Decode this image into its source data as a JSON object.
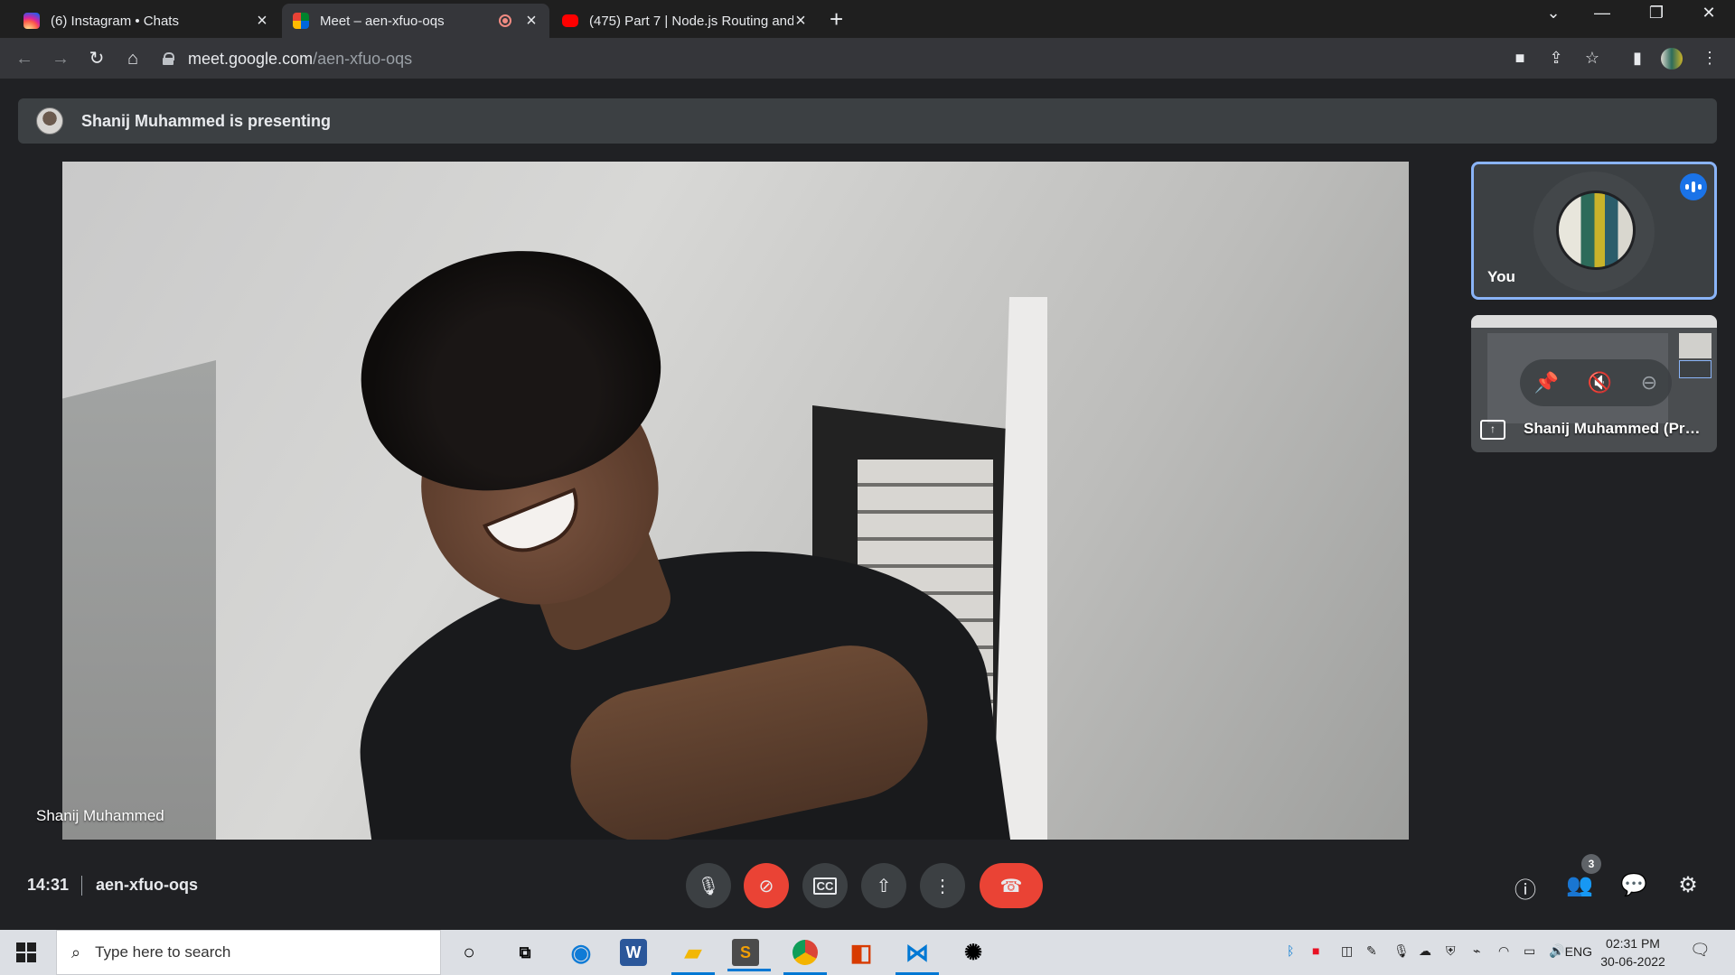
{
  "browser": {
    "tabs": [
      {
        "title": "(6) Instagram • Chats",
        "favicon": "instagram-icon",
        "active": false
      },
      {
        "title": "Meet – aen-xfuo-oqs",
        "favicon": "google-meet-icon",
        "active": true,
        "recording": true
      },
      {
        "title": "(475) Part 7 | Node.js Routing and",
        "favicon": "youtube-icon",
        "active": false
      }
    ],
    "url_host": "meet.google.com",
    "url_path": "/aen-xfuo-oqs"
  },
  "meet": {
    "banner_text": "Shanij Muhammed is presenting",
    "main_participant": "Shanij Muhammed",
    "self_tile_label": "You",
    "presentation_tile_label": "Shanij Muhammed (Presentation)",
    "time": "14:31",
    "meeting_code": "aen-xfuo-oqs",
    "participant_count": "3",
    "accent_color": "#8ab4f8",
    "end_call_color": "#ea4335"
  },
  "taskbar": {
    "search_placeholder": "Type here to search",
    "language": "ENG",
    "time": "02:31 PM",
    "date": "30-06-2022"
  }
}
